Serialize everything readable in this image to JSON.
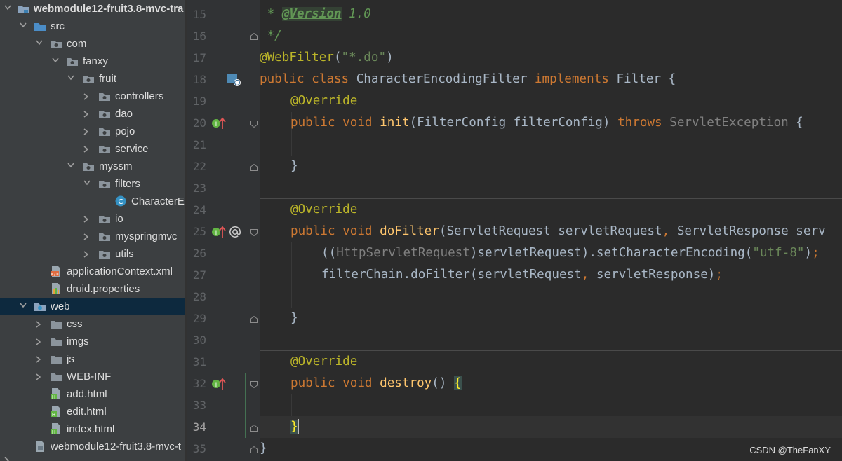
{
  "project_tree": {
    "items": [
      {
        "label": "webmodule12-fruit3.8-mvc-tra",
        "level": 0,
        "expanded": true,
        "icon": "module-folder-icon",
        "bold": true
      },
      {
        "label": "src",
        "level": 1,
        "expanded": true,
        "icon": "source-folder-icon"
      },
      {
        "label": "com",
        "level": 2,
        "expanded": true,
        "icon": "package-icon"
      },
      {
        "label": "fanxy",
        "level": 3,
        "expanded": true,
        "icon": "package-icon"
      },
      {
        "label": "fruit",
        "level": 4,
        "expanded": true,
        "icon": "package-icon"
      },
      {
        "label": "controllers",
        "level": 5,
        "expanded": false,
        "icon": "package-icon"
      },
      {
        "label": "dao",
        "level": 5,
        "expanded": false,
        "icon": "package-icon"
      },
      {
        "label": "pojo",
        "level": 5,
        "expanded": false,
        "icon": "package-icon"
      },
      {
        "label": "service",
        "level": 5,
        "expanded": false,
        "icon": "package-icon"
      },
      {
        "label": "myssm",
        "level": 4,
        "expanded": true,
        "icon": "package-icon"
      },
      {
        "label": "filters",
        "level": 5,
        "expanded": true,
        "icon": "package-icon"
      },
      {
        "label": "CharacterEn",
        "level": 6,
        "expanded": null,
        "icon": "java-class-icon"
      },
      {
        "label": "io",
        "level": 5,
        "expanded": false,
        "icon": "package-icon"
      },
      {
        "label": "myspringmvc",
        "level": 5,
        "expanded": false,
        "icon": "package-icon"
      },
      {
        "label": "utils",
        "level": 5,
        "expanded": false,
        "icon": "package-icon"
      },
      {
        "label": "applicationContext.xml",
        "level": 2,
        "expanded": null,
        "icon": "xml-file-icon"
      },
      {
        "label": "druid.properties",
        "level": 2,
        "expanded": null,
        "icon": "properties-file-icon"
      },
      {
        "label": "web",
        "level": 1,
        "expanded": true,
        "icon": "web-folder-icon",
        "selected": true
      },
      {
        "label": "css",
        "level": 2,
        "expanded": false,
        "icon": "folder-icon"
      },
      {
        "label": "imgs",
        "level": 2,
        "expanded": false,
        "icon": "folder-icon"
      },
      {
        "label": "js",
        "level": 2,
        "expanded": false,
        "icon": "folder-icon"
      },
      {
        "label": "WEB-INF",
        "level": 2,
        "expanded": false,
        "icon": "folder-icon"
      },
      {
        "label": "add.html",
        "level": 2,
        "expanded": null,
        "icon": "html-file-icon"
      },
      {
        "label": "edit.html",
        "level": 2,
        "expanded": null,
        "icon": "html-file-icon"
      },
      {
        "label": "index.html",
        "level": 2,
        "expanded": null,
        "icon": "html-file-icon"
      },
      {
        "label": "webmodule12-fruit3.8-mvc-t",
        "level": 1,
        "expanded": null,
        "icon": "iml-file-icon"
      }
    ]
  },
  "editor": {
    "line_numbers": [
      "15",
      "16",
      "17",
      "18",
      "19",
      "20",
      "21",
      "22",
      "23",
      "24",
      "25",
      "26",
      "27",
      "28",
      "29",
      "30",
      "31",
      "32",
      "33",
      "34",
      "35"
    ],
    "current_line": "34",
    "code": {
      "l15_star": " * ",
      "l15_tag": "@Version",
      "l15_val": " 1.0",
      "l16": " */",
      "l17_ann": "@WebFilter",
      "l17_p1": "(",
      "l17_str": "\"*.do\"",
      "l17_p2": ")",
      "l18_kw1": "public class ",
      "l18_name": "CharacterEncodingFilter ",
      "l18_kw2": "implements ",
      "l18_rest": "Filter {",
      "override": "@Override",
      "l20_kw": "public void ",
      "l20_fn": "init",
      "l20_args": "(FilterConfig filterConfig) ",
      "l20_throws": "throws ",
      "l20_exc": "ServletException",
      "l20_brace": " {",
      "close_brace": "}",
      "l25_kw": "public void ",
      "l25_fn": "doFilter",
      "l25_a1": "(ServletRequest servletRequest",
      "l25_comma": ", ",
      "l25_a2": "ServletResponse serv",
      "l26_p": "((",
      "l26_cast": "HttpServletRequest",
      "l26_mid": ")servletRequest).setCharacterEncoding(",
      "l26_str": "\"utf-8\"",
      "l26_end": ")",
      "l26_semi": ";",
      "l27_a": "filterChain.doFilter(servletRequest",
      "l27_comma": ", ",
      "l27_b": "servletResponse)",
      "l27_semi": ";",
      "l32_kw": "public void ",
      "l32_fn": "destroy",
      "l32_args": "() ",
      "l32_brace": "{",
      "l34_brace": "}",
      "l35_brace": "}"
    }
  },
  "watermark": "CSDN @TheFanXY",
  "colors": {
    "keyword": "#cc7832",
    "annotation": "#bbb529",
    "method": "#ffc66d",
    "string": "#6a8759",
    "plain": "#a9b7c6"
  }
}
